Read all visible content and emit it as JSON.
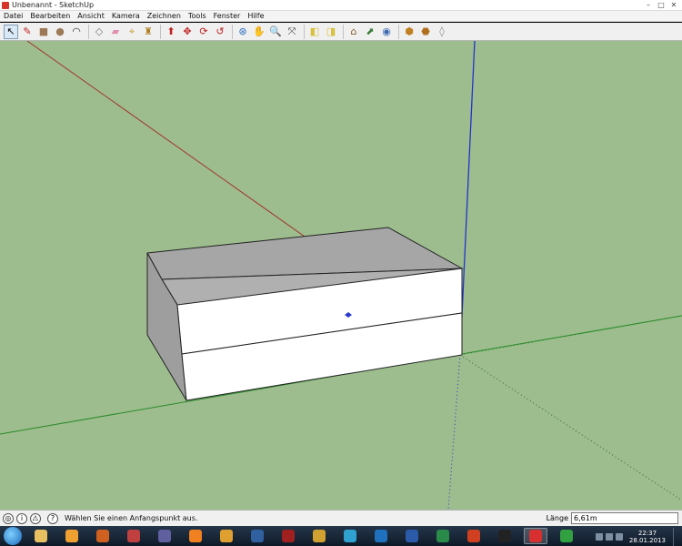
{
  "window": {
    "title": "Unbenannt - SketchUp",
    "controls": [
      "–",
      "□",
      "✕"
    ]
  },
  "menubar": {
    "items": [
      "Datei",
      "Bearbeiten",
      "Ansicht",
      "Kamera",
      "Zeichnen",
      "Tools",
      "Fenster",
      "Hilfe"
    ]
  },
  "toolbar": {
    "tools": [
      {
        "icon": "select-arrow-icon",
        "glyph": "↖",
        "color": "#111111"
      },
      {
        "icon": "line-pencil-icon",
        "glyph": "✎",
        "color": "#c22020"
      },
      {
        "icon": "rectangle-icon",
        "glyph": "■",
        "color": "#9b7a55"
      },
      {
        "icon": "circle-icon",
        "glyph": "●",
        "color": "#9b7a55"
      },
      {
        "icon": "arc-icon",
        "glyph": "◠",
        "color": "#333333"
      },
      {
        "icon": "make-component-icon",
        "glyph": "◇",
        "color": "#777777"
      },
      {
        "icon": "eraser-icon",
        "glyph": "▰",
        "color": "#e08fb0"
      },
      {
        "icon": "tape-measure-icon",
        "glyph": "⌖",
        "color": "#c9a23a"
      },
      {
        "icon": "paint-bucket-icon",
        "glyph": "♜",
        "color": "#b08020"
      },
      {
        "icon": "push-pull-icon",
        "glyph": "⬆",
        "color": "#c22020"
      },
      {
        "icon": "move-icon",
        "glyph": "✥",
        "color": "#c22020"
      },
      {
        "icon": "rotate-icon",
        "glyph": "⟳",
        "color": "#c22020"
      },
      {
        "icon": "offset-icon",
        "glyph": "↺",
        "color": "#c22020"
      },
      {
        "icon": "orbit-icon",
        "glyph": "⊛",
        "color": "#2a6ac0"
      },
      {
        "icon": "pan-icon",
        "glyph": "✋",
        "color": "#444444"
      },
      {
        "icon": "zoom-icon",
        "glyph": "🔍",
        "color": "#444444"
      },
      {
        "icon": "zoom-extents-icon",
        "glyph": "⤧",
        "color": "#444444"
      },
      {
        "icon": "previous-view-icon",
        "glyph": "◧",
        "color": "#d8c040"
      },
      {
        "icon": "next-view-icon",
        "glyph": "◨",
        "color": "#d8c040"
      },
      {
        "icon": "get-models-icon",
        "glyph": "⌂",
        "color": "#8a5a2a"
      },
      {
        "icon": "share-model-icon",
        "glyph": "⬈",
        "color": "#3a7a3a"
      },
      {
        "icon": "geo-location-icon",
        "glyph": "◉",
        "color": "#3a6ab0"
      },
      {
        "icon": "components-icon",
        "glyph": "⬢",
        "color": "#c08020"
      },
      {
        "icon": "extension-warehouse-icon",
        "glyph": "⬣",
        "color": "#b07020"
      },
      {
        "icon": "send-to-layout-icon",
        "glyph": "◊",
        "color": "#888888"
      }
    ]
  },
  "statusbar": {
    "text": "Wählen Sie einen Anfangspunkt aus.",
    "measure_label": "Länge",
    "measure_value": "6,61m"
  },
  "taskbar": {
    "apps": [
      {
        "name": "explorer",
        "color": "#e8c060"
      },
      {
        "name": "browser",
        "color": "#f0a030"
      },
      {
        "name": "app-3",
        "color": "#d06020"
      },
      {
        "name": "app-4",
        "color": "#c04040"
      },
      {
        "name": "media",
        "color": "#6060a0"
      },
      {
        "name": "vlc",
        "color": "#f08020"
      },
      {
        "name": "app-7",
        "color": "#e0a030"
      },
      {
        "name": "pd",
        "color": "#3060a0"
      },
      {
        "name": "app-9",
        "color": "#a02020"
      },
      {
        "name": "app-10",
        "color": "#d0a030"
      },
      {
        "name": "app-11",
        "color": "#30a0d0"
      },
      {
        "name": "app-12",
        "color": "#2070c0"
      },
      {
        "name": "word",
        "color": "#2a5aa8"
      },
      {
        "name": "excel",
        "color": "#2a8a4a"
      },
      {
        "name": "app-15",
        "color": "#d04020"
      },
      {
        "name": "terminal",
        "color": "#222222"
      },
      {
        "name": "sketchup",
        "color": "#d83030"
      },
      {
        "name": "app-18",
        "color": "#30a040"
      }
    ],
    "time": "22:37",
    "date": "28.01.2013"
  }
}
